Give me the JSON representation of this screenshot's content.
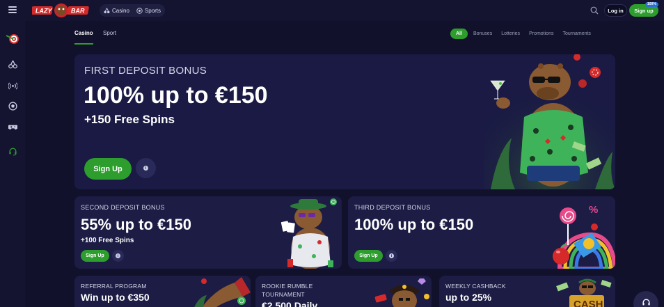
{
  "header": {
    "logo_text": "LAZY BAR",
    "nav": [
      {
        "label": "Casino",
        "icon": "cherries-icon"
      },
      {
        "label": "Sports",
        "icon": "soccer-ball-icon"
      }
    ],
    "login_label": "Log in",
    "signup_label": "Sign up",
    "signup_badge": "100%"
  },
  "sidebar": {
    "items": [
      {
        "name": "dartboard-icon"
      },
      {
        "name": "cherries-icon"
      },
      {
        "name": "live-broadcast-icon"
      },
      {
        "name": "soccer-ball-icon"
      },
      {
        "name": "gamepad-icon"
      },
      {
        "name": "headset-icon"
      }
    ]
  },
  "tabs": [
    {
      "label": "Casino",
      "active": true
    },
    {
      "label": "Sport",
      "active": false
    }
  ],
  "filters": [
    {
      "label": "All",
      "active": true
    },
    {
      "label": "Bonuses"
    },
    {
      "label": "Lotteries"
    },
    {
      "label": "Promotions"
    },
    {
      "label": "Tournaments"
    }
  ],
  "cards": {
    "first": {
      "title": "FIRST DEPOSIT BONUS",
      "main": "100% up to €150",
      "sub": "+150 Free Spins",
      "cta": "Sign Up",
      "info": "i"
    },
    "second": {
      "title": "SECOND DEPOSIT BONUS",
      "main": "55% up to €150",
      "sub": "+100 Free Spins",
      "cta": "Sign Up",
      "info": "i"
    },
    "third": {
      "title": "THIRD DEPOSIT BONUS",
      "main": "100% up to €150",
      "cta": "Sign Up",
      "info": "i"
    },
    "referral": {
      "title": "REFERRAL PROGRAM",
      "main": "Win up to €350"
    },
    "rookie": {
      "title_line1": "ROOKIE RUMBLE",
      "title_line2": "TOURNAMENT",
      "main": "€2,500 Daily"
    },
    "cashback": {
      "title": "WEEKLY CASHBACK",
      "main": "up to 25%",
      "art_text": "CASH"
    }
  },
  "colors": {
    "accent_green": "#2d9e2d",
    "background": "#11112b",
    "card": "#1c1c45",
    "badge_blue": "#2d6fd6"
  }
}
